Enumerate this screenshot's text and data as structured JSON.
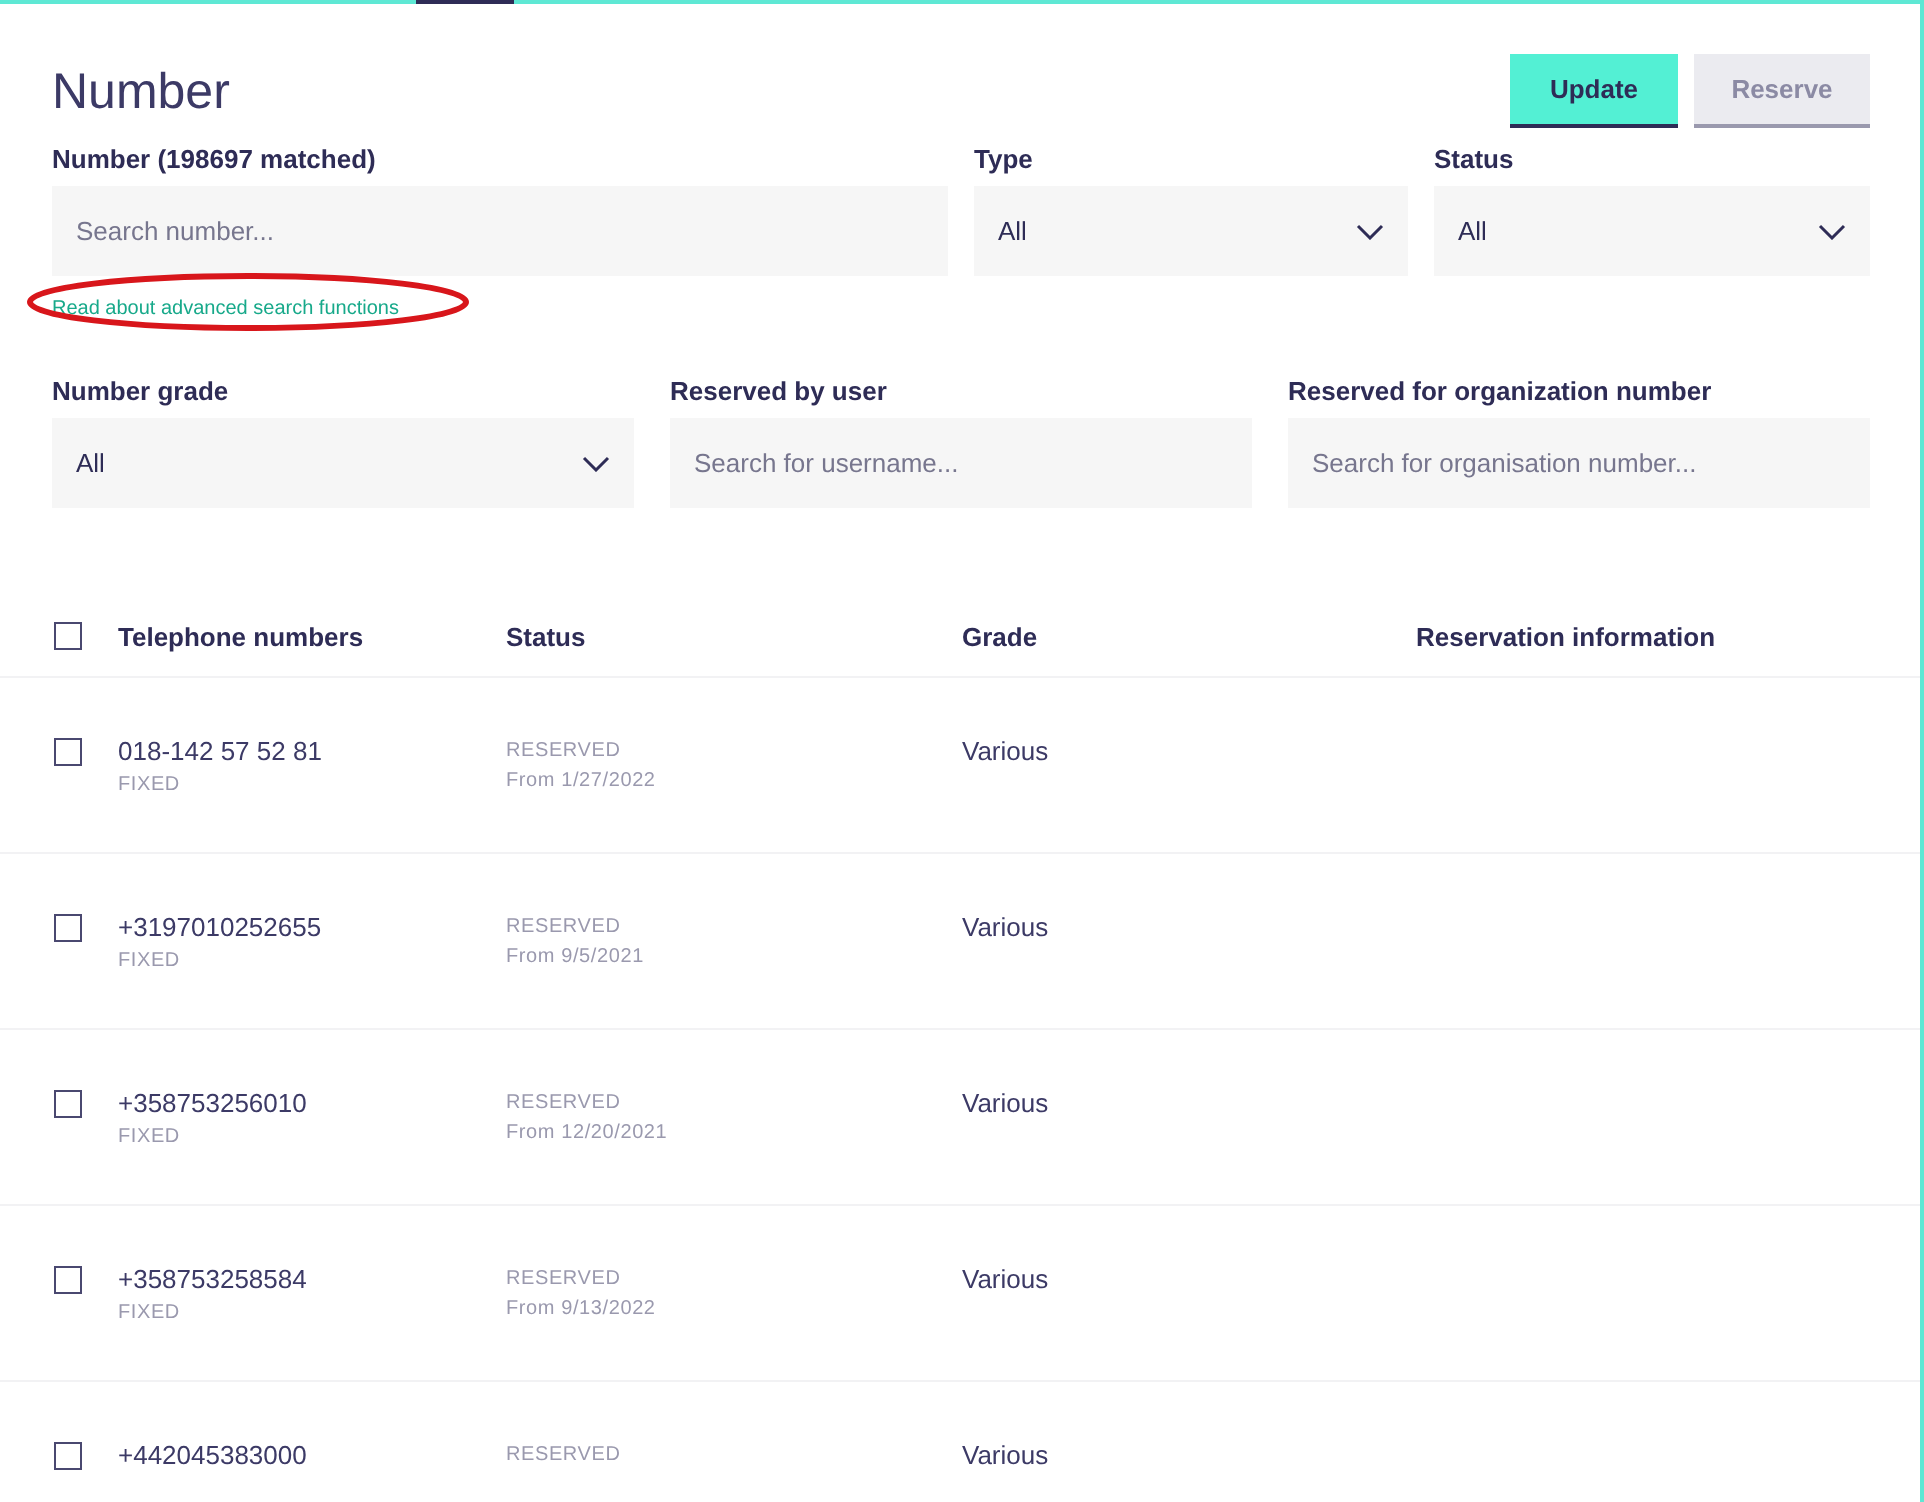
{
  "page": {
    "title": "Number"
  },
  "buttons": [
    {
      "label": "Update",
      "kind": "primary"
    },
    {
      "label": "Reserve",
      "kind": "secondary"
    }
  ],
  "filters_top": [
    {
      "label": "Number (198697 matched)",
      "kind": "search",
      "placeholder": "Search number..."
    },
    {
      "label": "Type",
      "kind": "select",
      "value": "All"
    },
    {
      "label": "Status",
      "kind": "select",
      "value": "All"
    }
  ],
  "advanced_link": {
    "text": "Read about advanced search functions",
    "circled": true
  },
  "filters_bottom": [
    {
      "label": "Number grade",
      "kind": "select",
      "value": "All"
    },
    {
      "label": "Reserved by user",
      "kind": "search",
      "placeholder": "Search for username..."
    },
    {
      "label": "Reserved for organization number",
      "kind": "search",
      "placeholder": "Search for organisation number..."
    }
  ],
  "table": {
    "select_all_checked": false,
    "columns": [
      "Telephone numbers",
      "Status",
      "Grade",
      "Reservation information"
    ],
    "rows": [
      {
        "checked": false,
        "number": "018-142 57 52 81",
        "type": "FIXED",
        "status": "RESERVED",
        "since": "From 1/27/2022",
        "grade": "Various"
      },
      {
        "checked": false,
        "number": "+3197010252655",
        "type": "FIXED",
        "status": "RESERVED",
        "since": "From 9/5/2021",
        "grade": "Various"
      },
      {
        "checked": false,
        "number": "+358753256010",
        "type": "FIXED",
        "status": "RESERVED",
        "since": "From 12/20/2021",
        "grade": "Various"
      },
      {
        "checked": false,
        "number": "+358753258584",
        "type": "FIXED",
        "status": "RESERVED",
        "since": "From 9/13/2022",
        "grade": "Various"
      },
      {
        "checked": false,
        "number": "+442045383000",
        "status": "RESERVED",
        "grade": "Various"
      }
    ]
  }
}
